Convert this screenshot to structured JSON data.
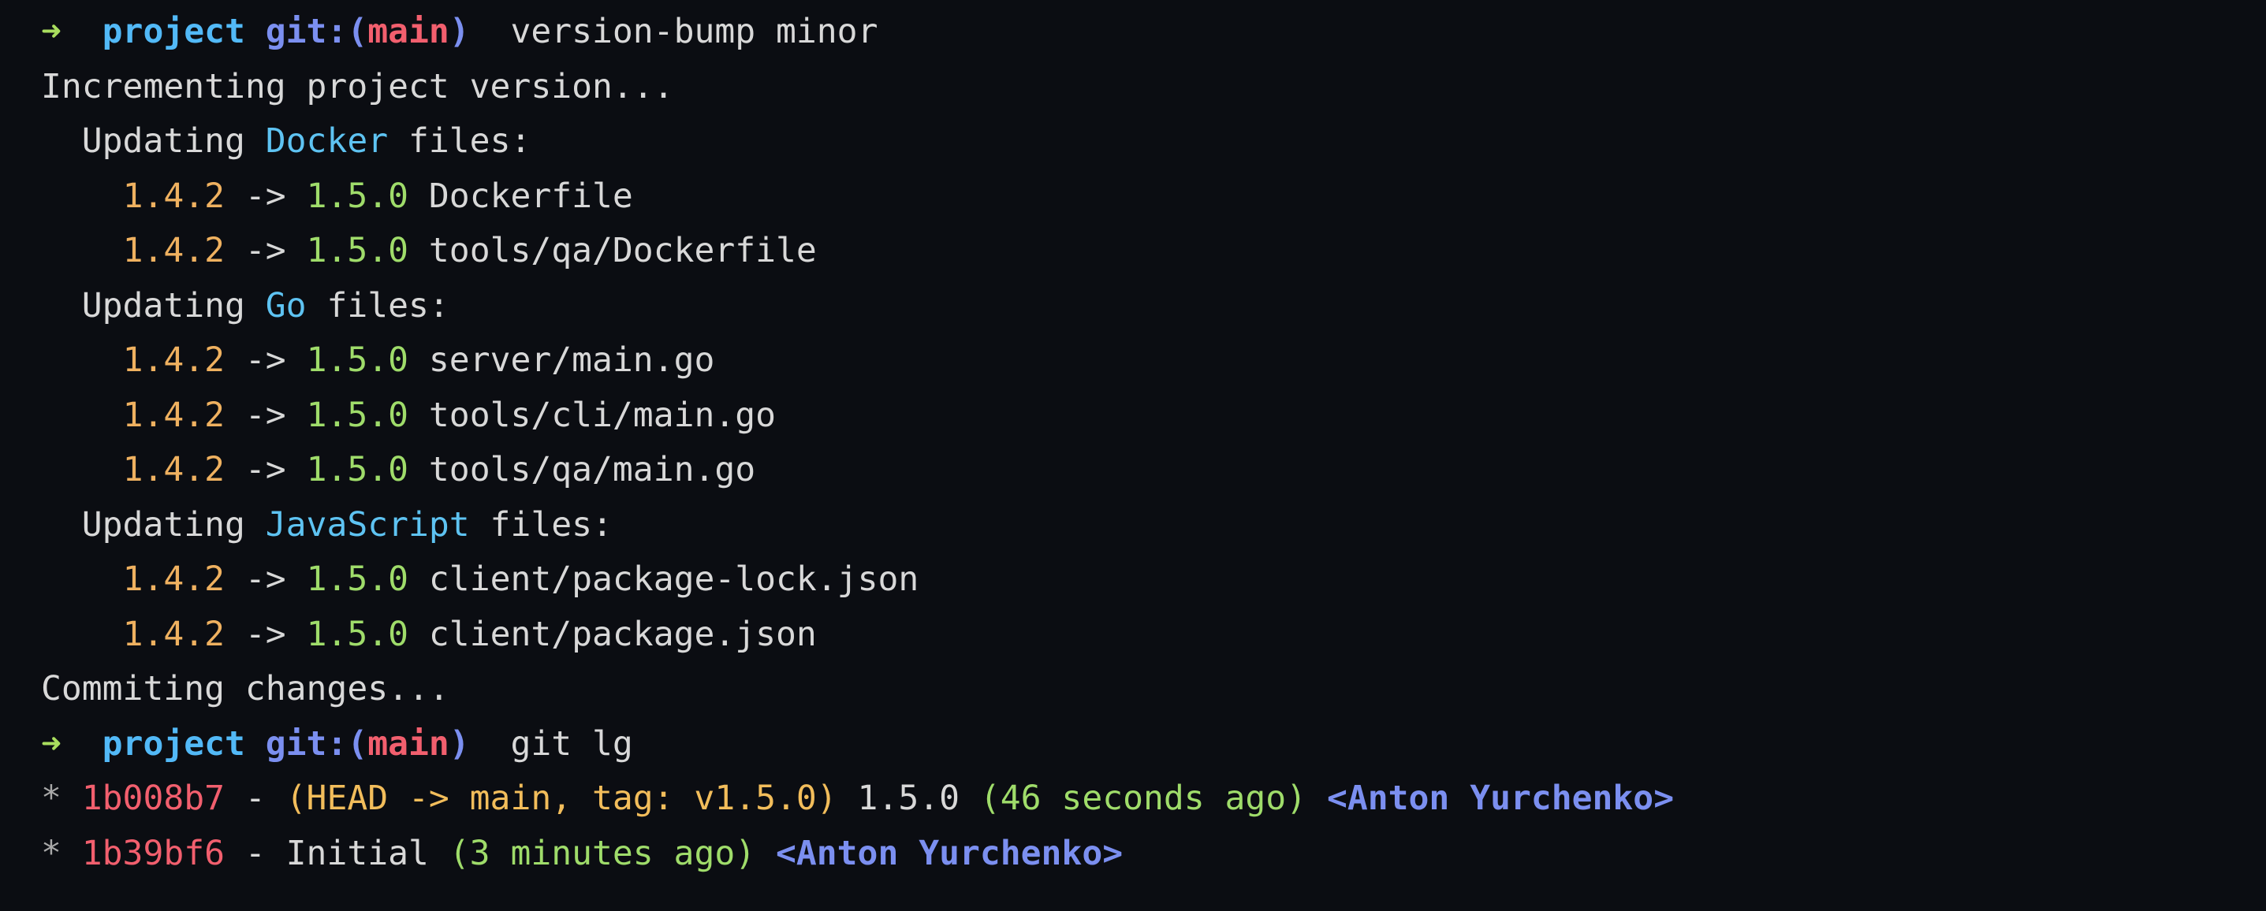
{
  "terminal": {
    "background_color": "#0b0d12",
    "default_text_color": "#d8d8d8",
    "colors": {
      "arrow_green": "#a9dd5e",
      "prompt_cyan": "#52b9f7",
      "prompt_blue": "#7b8ff0",
      "branch_red": "#f25f6e",
      "lang_cyan": "#5ec3f2",
      "old_version_orange": "#efb160",
      "new_version_green": "#9fdc6a",
      "white": "#d8d8d8",
      "commit_hash_red": "#f25f6e",
      "ref_yellow": "#f2bd5b",
      "time_green": "#9fdc6a",
      "author_blue": "#7b8ff0",
      "star_gray": "#a8a8a8"
    },
    "lines": [
      {
        "name": "prompt-line-version-bump",
        "segments": [
          {
            "name": "prompt-arrow-icon",
            "text": "➜",
            "color": "#a9dd5e",
            "bold": true
          },
          {
            "name": "prompt-space",
            "text": "  ",
            "color": "#d8d8d8",
            "bold": false
          },
          {
            "name": "prompt-directory",
            "text": "project",
            "color": "#52b9f7",
            "bold": true
          },
          {
            "name": "prompt-space-2",
            "text": " ",
            "color": "#d8d8d8",
            "bold": false
          },
          {
            "name": "prompt-git-label",
            "text": "git:",
            "color": "#7b8ff0",
            "bold": true
          },
          {
            "name": "prompt-paren-open",
            "text": "(",
            "color": "#7b8ff0",
            "bold": true
          },
          {
            "name": "prompt-branch-name",
            "text": "main",
            "color": "#f25f6e",
            "bold": true
          },
          {
            "name": "prompt-paren-close",
            "text": ")",
            "color": "#7b8ff0",
            "bold": true
          },
          {
            "name": "prompt-command",
            "text": "  version-bump minor",
            "color": "#d8d8d8",
            "bold": false
          }
        ]
      },
      {
        "name": "output-incrementing",
        "segments": [
          {
            "name": "output-text",
            "text": "Incrementing project version...",
            "color": "#d8d8d8",
            "bold": false
          }
        ]
      },
      {
        "name": "output-updating-docker",
        "segments": [
          {
            "name": "output-indent",
            "text": "  Updating ",
            "color": "#d8d8d8",
            "bold": false
          },
          {
            "name": "language-name-docker",
            "text": "Docker",
            "color": "#5ec3f2",
            "bold": false
          },
          {
            "name": "output-files-suffix",
            "text": " files:",
            "color": "#d8d8d8",
            "bold": false
          }
        ]
      },
      {
        "name": "output-bump-dockerfile",
        "segments": [
          {
            "name": "output-indent",
            "text": "    ",
            "color": "#d8d8d8",
            "bold": false
          },
          {
            "name": "old-version",
            "text": "1.4.2",
            "color": "#efb160",
            "bold": false
          },
          {
            "name": "arrow-separator",
            "text": " -> ",
            "color": "#d8d8d8",
            "bold": false
          },
          {
            "name": "new-version",
            "text": "1.5.0",
            "color": "#9fdc6a",
            "bold": false
          },
          {
            "name": "file-path",
            "text": " Dockerfile",
            "color": "#d8d8d8",
            "bold": false
          }
        ]
      },
      {
        "name": "output-bump-tools-qa-dockerfile",
        "segments": [
          {
            "name": "output-indent",
            "text": "    ",
            "color": "#d8d8d8",
            "bold": false
          },
          {
            "name": "old-version",
            "text": "1.4.2",
            "color": "#efb160",
            "bold": false
          },
          {
            "name": "arrow-separator",
            "text": " -> ",
            "color": "#d8d8d8",
            "bold": false
          },
          {
            "name": "new-version",
            "text": "1.5.0",
            "color": "#9fdc6a",
            "bold": false
          },
          {
            "name": "file-path",
            "text": " tools/qa/Dockerfile",
            "color": "#d8d8d8",
            "bold": false
          }
        ]
      },
      {
        "name": "output-updating-go",
        "segments": [
          {
            "name": "output-indent",
            "text": "  Updating ",
            "color": "#d8d8d8",
            "bold": false
          },
          {
            "name": "language-name-go",
            "text": "Go",
            "color": "#5ec3f2",
            "bold": false
          },
          {
            "name": "output-files-suffix",
            "text": " files:",
            "color": "#d8d8d8",
            "bold": false
          }
        ]
      },
      {
        "name": "output-bump-server-main-go",
        "segments": [
          {
            "name": "output-indent",
            "text": "    ",
            "color": "#d8d8d8",
            "bold": false
          },
          {
            "name": "old-version",
            "text": "1.4.2",
            "color": "#efb160",
            "bold": false
          },
          {
            "name": "arrow-separator",
            "text": " -> ",
            "color": "#d8d8d8",
            "bold": false
          },
          {
            "name": "new-version",
            "text": "1.5.0",
            "color": "#9fdc6a",
            "bold": false
          },
          {
            "name": "file-path",
            "text": " server/main.go",
            "color": "#d8d8d8",
            "bold": false
          }
        ]
      },
      {
        "name": "output-bump-tools-cli-main-go",
        "segments": [
          {
            "name": "output-indent",
            "text": "    ",
            "color": "#d8d8d8",
            "bold": false
          },
          {
            "name": "old-version",
            "text": "1.4.2",
            "color": "#efb160",
            "bold": false
          },
          {
            "name": "arrow-separator",
            "text": " -> ",
            "color": "#d8d8d8",
            "bold": false
          },
          {
            "name": "new-version",
            "text": "1.5.0",
            "color": "#9fdc6a",
            "bold": false
          },
          {
            "name": "file-path",
            "text": " tools/cli/main.go",
            "color": "#d8d8d8",
            "bold": false
          }
        ]
      },
      {
        "name": "output-bump-tools-qa-main-go",
        "segments": [
          {
            "name": "output-indent",
            "text": "    ",
            "color": "#d8d8d8",
            "bold": false
          },
          {
            "name": "old-version",
            "text": "1.4.2",
            "color": "#efb160",
            "bold": false
          },
          {
            "name": "arrow-separator",
            "text": " -> ",
            "color": "#d8d8d8",
            "bold": false
          },
          {
            "name": "new-version",
            "text": "1.5.0",
            "color": "#9fdc6a",
            "bold": false
          },
          {
            "name": "file-path",
            "text": " tools/qa/main.go",
            "color": "#d8d8d8",
            "bold": false
          }
        ]
      },
      {
        "name": "output-updating-javascript",
        "segments": [
          {
            "name": "output-indent",
            "text": "  Updating ",
            "color": "#d8d8d8",
            "bold": false
          },
          {
            "name": "language-name-javascript",
            "text": "JavaScript",
            "color": "#5ec3f2",
            "bold": false
          },
          {
            "name": "output-files-suffix",
            "text": " files:",
            "color": "#d8d8d8",
            "bold": false
          }
        ]
      },
      {
        "name": "output-bump-package-lock-json",
        "segments": [
          {
            "name": "output-indent",
            "text": "    ",
            "color": "#d8d8d8",
            "bold": false
          },
          {
            "name": "old-version",
            "text": "1.4.2",
            "color": "#efb160",
            "bold": false
          },
          {
            "name": "arrow-separator",
            "text": " -> ",
            "color": "#d8d8d8",
            "bold": false
          },
          {
            "name": "new-version",
            "text": "1.5.0",
            "color": "#9fdc6a",
            "bold": false
          },
          {
            "name": "file-path",
            "text": " client/package-lock.json",
            "color": "#d8d8d8",
            "bold": false
          }
        ]
      },
      {
        "name": "output-bump-package-json",
        "segments": [
          {
            "name": "output-indent",
            "text": "    ",
            "color": "#d8d8d8",
            "bold": false
          },
          {
            "name": "old-version",
            "text": "1.4.2",
            "color": "#efb160",
            "bold": false
          },
          {
            "name": "arrow-separator",
            "text": " -> ",
            "color": "#d8d8d8",
            "bold": false
          },
          {
            "name": "new-version",
            "text": "1.5.0",
            "color": "#9fdc6a",
            "bold": false
          },
          {
            "name": "file-path",
            "text": " client/package.json",
            "color": "#d8d8d8",
            "bold": false
          }
        ]
      },
      {
        "name": "output-commiting-changes",
        "segments": [
          {
            "name": "output-text",
            "text": "Commiting changes...",
            "color": "#d8d8d8",
            "bold": false
          }
        ]
      },
      {
        "name": "prompt-line-git-lg",
        "segments": [
          {
            "name": "prompt-arrow-icon",
            "text": "➜",
            "color": "#a9dd5e",
            "bold": true
          },
          {
            "name": "prompt-space",
            "text": "  ",
            "color": "#d8d8d8",
            "bold": false
          },
          {
            "name": "prompt-directory",
            "text": "project",
            "color": "#52b9f7",
            "bold": true
          },
          {
            "name": "prompt-space-2",
            "text": " ",
            "color": "#d8d8d8",
            "bold": false
          },
          {
            "name": "prompt-git-label",
            "text": "git:",
            "color": "#7b8ff0",
            "bold": true
          },
          {
            "name": "prompt-paren-open",
            "text": "(",
            "color": "#7b8ff0",
            "bold": true
          },
          {
            "name": "prompt-branch-name",
            "text": "main",
            "color": "#f25f6e",
            "bold": true
          },
          {
            "name": "prompt-paren-close",
            "text": ")",
            "color": "#7b8ff0",
            "bold": true
          },
          {
            "name": "prompt-command",
            "text": "  git lg",
            "color": "#d8d8d8",
            "bold": false
          }
        ]
      },
      {
        "name": "git-log-entry-1b008b7",
        "segments": [
          {
            "name": "git-graph-star",
            "text": "* ",
            "color": "#a8a8a8",
            "bold": false
          },
          {
            "name": "commit-hash",
            "text": "1b008b7",
            "color": "#f25f6e",
            "bold": false
          },
          {
            "name": "hash-separator",
            "text": " - ",
            "color": "#d8d8d8",
            "bold": false
          },
          {
            "name": "commit-refs",
            "text": "(HEAD -> main, tag: v1.5.0)",
            "color": "#f2bd5b",
            "bold": false
          },
          {
            "name": "commit-message",
            "text": " 1.5.0 ",
            "color": "#d8d8d8",
            "bold": false
          },
          {
            "name": "commit-relative-time",
            "text": "(46 seconds ago)",
            "color": "#9fdc6a",
            "bold": false
          },
          {
            "name": "spacer",
            "text": " ",
            "color": "#d8d8d8",
            "bold": false
          },
          {
            "name": "commit-author",
            "text": "<Anton Yurchenko>",
            "color": "#7b8ff0",
            "bold": true
          }
        ]
      },
      {
        "name": "git-log-entry-1b39bf6",
        "segments": [
          {
            "name": "git-graph-star",
            "text": "* ",
            "color": "#a8a8a8",
            "bold": false
          },
          {
            "name": "commit-hash",
            "text": "1b39bf6",
            "color": "#f25f6e",
            "bold": false
          },
          {
            "name": "hash-separator",
            "text": " - ",
            "color": "#d8d8d8",
            "bold": false
          },
          {
            "name": "commit-message",
            "text": "Initial ",
            "color": "#d8d8d8",
            "bold": false
          },
          {
            "name": "commit-relative-time",
            "text": "(3 minutes ago)",
            "color": "#9fdc6a",
            "bold": false
          },
          {
            "name": "spacer",
            "text": " ",
            "color": "#d8d8d8",
            "bold": false
          },
          {
            "name": "commit-author",
            "text": "<Anton Yurchenko>",
            "color": "#7b8ff0",
            "bold": true
          }
        ]
      }
    ]
  }
}
